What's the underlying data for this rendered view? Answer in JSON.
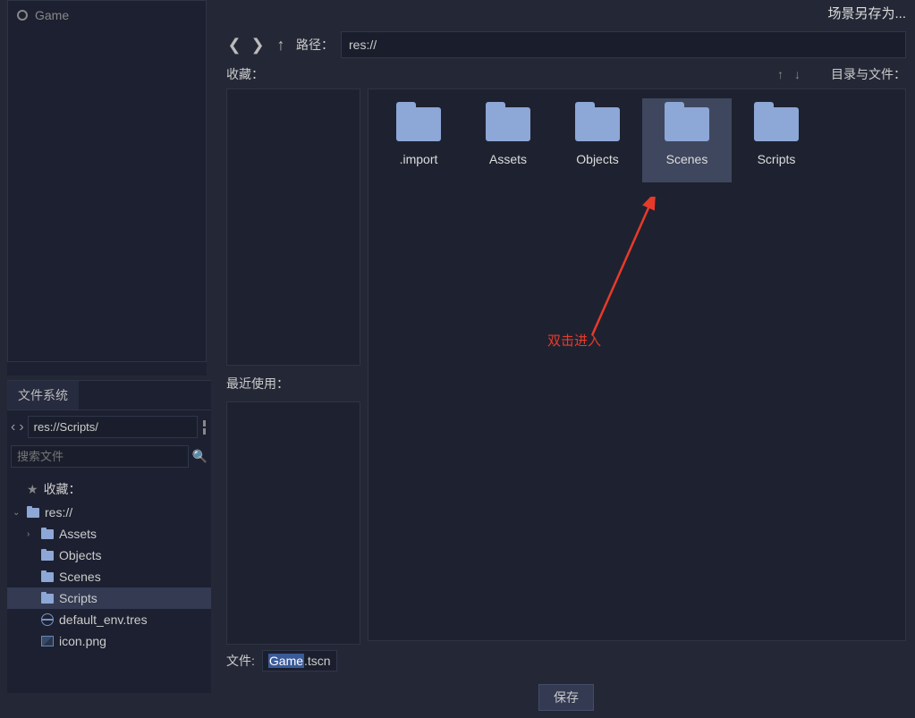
{
  "scene": {
    "root": "Game"
  },
  "fs_panel": {
    "tab": "文件系统",
    "path": "res://Scripts/",
    "search_placeholder": "搜索文件",
    "fav_label": "收藏：",
    "root": "res://",
    "items": [
      "Assets",
      "Objects",
      "Scenes",
      "Scripts",
      "default_env.tres",
      "icon.png"
    ],
    "selected": "Scripts"
  },
  "dialog": {
    "title": "场景另存为...",
    "path_label": "路径：",
    "path": "res://",
    "fav_label": "收藏：",
    "dirfiles_label": "目录与文件：",
    "recent_label": "最近使用：",
    "folders": [
      ".import",
      "Assets",
      "Objects",
      "Scenes",
      "Scripts"
    ],
    "selected_folder": "Scenes",
    "file_label": "文件:",
    "file_base": "Game",
    "file_ext": ".tscn",
    "save": "保存"
  },
  "annotation": {
    "text": "双击进入"
  }
}
